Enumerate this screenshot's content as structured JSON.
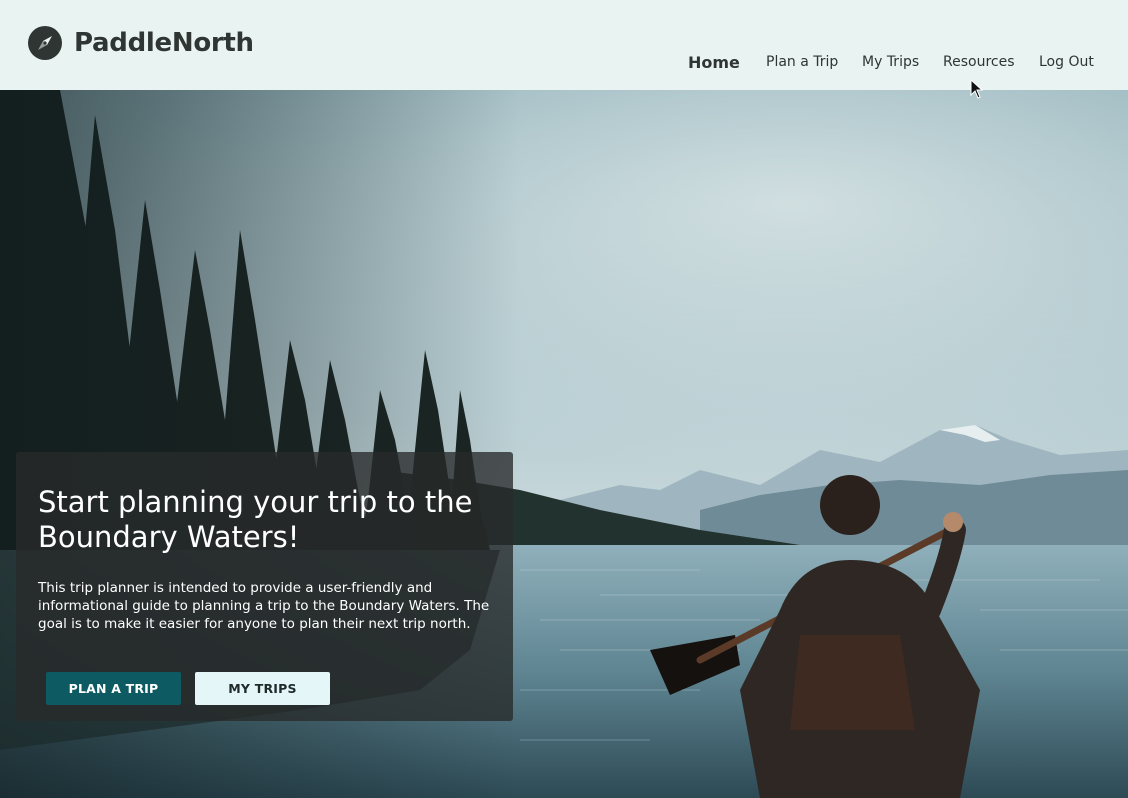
{
  "header": {
    "brand": {
      "name": "PaddleNorth",
      "icon": "compass-icon"
    },
    "nav": [
      {
        "label": "Home",
        "active": true
      },
      {
        "label": "Plan a Trip",
        "active": false
      },
      {
        "label": "My Trips",
        "active": false
      },
      {
        "label": "Resources",
        "active": false
      },
      {
        "label": "Log Out",
        "active": false
      }
    ]
  },
  "hero": {
    "image": "canoe-lake-mountains-photo",
    "card": {
      "title": "Start planning your trip to the Boundary Waters!",
      "body": "This trip planner is intended to provide a user-friendly and informational guide to planning a trip to the Boundary Waters. The goal is to make it easier for anyone to plan their next trip north.",
      "primary_button": "PLAN A TRIP",
      "secondary_button": "MY TRIPS"
    }
  },
  "colors": {
    "header_bg": "#e9f3f2",
    "primary": "#0d5a63",
    "secondary_button_bg": "#e4f6f7",
    "text_dark": "#2f3533"
  }
}
